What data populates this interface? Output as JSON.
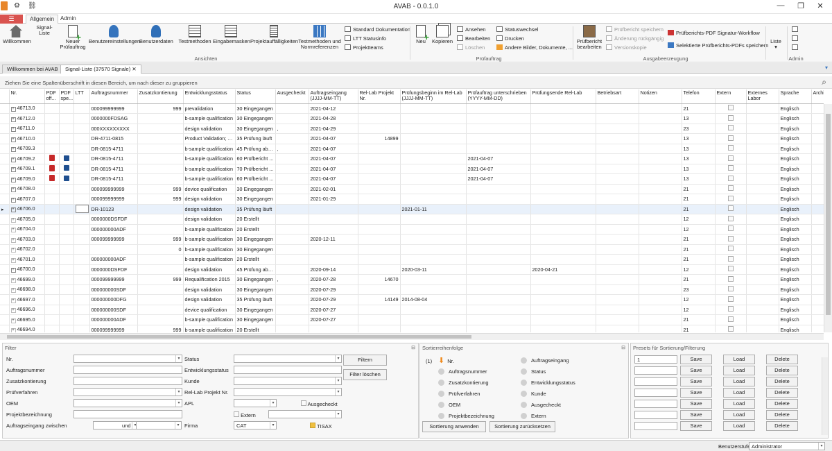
{
  "window": {
    "title": "AVAB - 0.0.1.0",
    "min": "—",
    "max": "❐",
    "close": "✕"
  },
  "ribbon_tabs": [
    {
      "label": "Allgemein"
    },
    {
      "label": "Admin"
    }
  ],
  "ribbon": {
    "buttons": [
      {
        "label": "Willkommen"
      },
      {
        "label": "Signal-Liste"
      },
      {
        "label": "Neuer Prüfauftrag"
      },
      {
        "label": "Benutzereinstellungen"
      },
      {
        "label": "Benutzerdaten"
      },
      {
        "label": "Testmethoden"
      },
      {
        "label": "Eingabemasken"
      },
      {
        "label": "Projektauffälligkeiten"
      },
      {
        "label": "Testmethoden und Normreferenzen"
      },
      {
        "label": "Neu"
      },
      {
        "label": "Kopieren"
      },
      {
        "label": "Prüfbericht bearbeiten"
      },
      {
        "label": "Liste"
      }
    ],
    "small": [
      {
        "label": "Standard Dokumentation"
      },
      {
        "label": "LTT Statusinfo"
      },
      {
        "label": "Projektteams"
      },
      {
        "label": "Ansehen"
      },
      {
        "label": "Bearbeiten"
      },
      {
        "label": "Löschen"
      },
      {
        "label": "Statuswechsel"
      },
      {
        "label": "Drucken"
      },
      {
        "label": "Andere Bilder, Dokumente, ..."
      },
      {
        "label": "Prüfbericht speichern"
      },
      {
        "label": "Änderung rückgängig"
      },
      {
        "label": "Versionskopie"
      },
      {
        "label": "Prüfberichts-PDF Signatur-Workflow"
      },
      {
        "label": "Selektierte Prüfberichts-PDFs speichern"
      }
    ],
    "groups": [
      {
        "label": "Ansichten"
      },
      {
        "label": "Prüfauftrag"
      },
      {
        "label": "Ausgabeerzeugung"
      },
      {
        "label": "Admin"
      }
    ]
  },
  "doc_tabs": [
    {
      "label": "Willkommen bei AVAB"
    },
    {
      "label": "Signal-Liste (37570 Signale)"
    }
  ],
  "group_hint": "Ziehen Sie eine Spaltenüberschrift in diesen Bereich, um nach dieser zu gruppieren",
  "columns": [
    "",
    "Nr.",
    "PDF off...",
    "PDF spe...",
    "LTT",
    "Auftragsnummer",
    "Zusatzkontierung",
    "Entwicklungsstatus",
    "Status",
    "Ausgecheckt",
    "Auftragseingang (JJJJ-MM-TT)",
    "Rel-Lab Projekt Nr.",
    "Prüfungsbeginn im Rel-Lab (JJJJ-MM-TT)",
    "Prüfauftrag unterschrieben (YYYY-MM-DD)",
    "Prüfungsende Rel-Lab",
    "Betriebsart",
    "Notizen",
    "Telefon",
    "Extern",
    "Externes Labor",
    "Sprache",
    "Archiv"
  ],
  "rows": [
    {
      "nr": "46713.0",
      "pdf": false,
      "save": false,
      "auftrag": "000099999999",
      "zusatz": "999",
      "entw": "prevalidation",
      "status": "30 Eingegangen",
      "aus": "",
      "eingang": "2021-04-12",
      "rellab": "",
      "beginn": "",
      "unter": "",
      "ende": "",
      "tel": "21",
      "lang": "Englisch"
    },
    {
      "nr": "46712.0",
      "pdf": false,
      "save": false,
      "auftrag": "0000000FDSAG",
      "zusatz": "",
      "entw": "b-sample qualification",
      "status": "30 Eingegangen",
      "aus": "",
      "eingang": "2021-04-28",
      "rellab": "",
      "beginn": "",
      "unter": "",
      "ende": "",
      "tel": "13",
      "lang": "Englisch"
    },
    {
      "nr": "46711.0",
      "pdf": false,
      "save": false,
      "auftrag": "000XXXXXXXXX",
      "zusatz": "",
      "entw": "design validation",
      "status": "30 Eingegangen",
      "aus": ",",
      "eingang": "2021-04-29",
      "rellab": "",
      "beginn": "",
      "unter": "",
      "ende": "",
      "tel": "23",
      "lang": "Englisch"
    },
    {
      "nr": "46710.0",
      "pdf": false,
      "save": false,
      "auftrag": "DR-4711-0815",
      "zusatz": "",
      "entw": "Product Validation; PV",
      "status": "35 Prüfung läuft",
      "aus": "",
      "eingang": "2021-04-07",
      "rellab": "14899",
      "beginn": "",
      "unter": "",
      "ende": "",
      "tel": "13",
      "lang": "Englisch"
    },
    {
      "nr": "46709.3",
      "pdf": false,
      "save": false,
      "auftrag": "DR-0815-4711",
      "zusatz": "",
      "entw": "b-sample qualification",
      "status": "45 Prüfung abg...",
      "aus": ",",
      "eingang": "2021-04-07",
      "rellab": "",
      "beginn": "",
      "unter": "",
      "ende": "",
      "tel": "13",
      "lang": "Englisch"
    },
    {
      "nr": "46709.2",
      "pdf": true,
      "save": true,
      "auftrag": "DR-0815-4711",
      "zusatz": "",
      "entw": "b-sample qualification",
      "status": "60 Prüfbericht ...",
      "aus": "",
      "eingang": "2021-04-07",
      "rellab": "",
      "beginn": "",
      "unter": "2021-04-07",
      "ende": "",
      "tel": "13",
      "lang": "Englisch"
    },
    {
      "nr": "46709.1",
      "pdf": true,
      "save": true,
      "auftrag": "DR-0815-4711",
      "zusatz": "",
      "entw": "b-sample qualification",
      "status": "70 Prüfbericht ...",
      "aus": "",
      "eingang": "2021-04-07",
      "rellab": "",
      "beginn": "",
      "unter": "2021-04-07",
      "ende": "",
      "tel": "13",
      "lang": "Englisch"
    },
    {
      "nr": "46709.0",
      "pdf": true,
      "save": true,
      "auftrag": "DR-0815-4711",
      "zusatz": "",
      "entw": "b-sample qualification",
      "status": "60 Prüfbericht ...",
      "aus": "",
      "eingang": "2021-04-07",
      "rellab": "",
      "beginn": "",
      "unter": "2021-04-07",
      "ende": "",
      "tel": "13",
      "lang": "Englisch"
    },
    {
      "nr": "46708.0",
      "pdf": false,
      "save": false,
      "auftrag": "000099999999",
      "zusatz": "999",
      "entw": "device qualification",
      "status": "30 Eingegangen",
      "aus": "",
      "eingang": "2021-02-01",
      "rellab": "",
      "beginn": "",
      "unter": "",
      "ende": "",
      "tel": "21",
      "lang": "Englisch"
    },
    {
      "nr": "46707.0",
      "pdf": false,
      "save": false,
      "auftrag": "000099999999",
      "zusatz": "999",
      "entw": "design validation",
      "status": "30 Eingegangen",
      "aus": "",
      "eingang": "2021-01-29",
      "rellab": "",
      "beginn": "",
      "unter": "",
      "ende": "",
      "tel": "21",
      "lang": "Englisch"
    },
    {
      "nr": "46706.0",
      "pdf": false,
      "save": false,
      "auftrag": "DR-10123",
      "zusatz": "",
      "entw": "design validation",
      "status": "35 Prüfung läuft",
      "aus": "",
      "eingang": "",
      "rellab": "",
      "beginn": "2021-01-11",
      "unter": "",
      "ende": "",
      "tel": "21",
      "lang": "Englisch",
      "selected": true
    },
    {
      "nr": "46705.0",
      "pdf": false,
      "save": false,
      "auftrag": "0000000DSFDF",
      "zusatz": "",
      "entw": "design validation",
      "status": "20 Erstellt",
      "aus": "",
      "eingang": "",
      "rellab": "",
      "beginn": "",
      "unter": "",
      "ende": "",
      "tel": "12",
      "lang": "Englisch"
    },
    {
      "nr": "46704.0",
      "pdf": false,
      "save": false,
      "auftrag": "000000000ADF",
      "zusatz": "",
      "entw": "b-sample qualification",
      "status": "20 Erstellt",
      "aus": "",
      "eingang": "",
      "rellab": "",
      "beginn": "",
      "unter": "",
      "ende": "",
      "tel": "12",
      "lang": "Englisch"
    },
    {
      "nr": "46703.0",
      "pdf": false,
      "save": false,
      "auftrag": "000099999999",
      "zusatz": "999",
      "entw": "b-sample qualification",
      "status": "30 Eingegangen",
      "aus": "",
      "eingang": "2020-12-11",
      "rellab": "",
      "beginn": "",
      "unter": "",
      "ende": "",
      "tel": "21",
      "lang": "Englisch"
    },
    {
      "nr": "46702.0",
      "pdf": false,
      "save": false,
      "auftrag": "",
      "zusatz": "0",
      "entw": "b-sample qualification",
      "status": "30 Eingegangen",
      "aus": "",
      "eingang": "",
      "rellab": "",
      "beginn": "",
      "unter": "",
      "ende": "",
      "tel": "21",
      "lang": "Englisch"
    },
    {
      "nr": "46701.0",
      "pdf": false,
      "save": false,
      "auftrag": "000000000ADF",
      "zusatz": "",
      "entw": "b-sample qualification",
      "status": "20 Erstellt",
      "aus": "",
      "eingang": "",
      "rellab": "",
      "beginn": "",
      "unter": "",
      "ende": "",
      "tel": "21",
      "lang": "Englisch"
    },
    {
      "nr": "46700.0",
      "pdf": false,
      "save": false,
      "auftrag": "0000000DSFDF",
      "zusatz": "",
      "entw": "design validation",
      "status": "45 Prüfung abg...",
      "aus": "",
      "eingang": "2020-09-14",
      "rellab": "",
      "beginn": "2020-03-11",
      "unter": "",
      "ende": "2020-04-21",
      "tel": "12",
      "lang": "Englisch"
    },
    {
      "nr": "46699.0",
      "pdf": false,
      "save": false,
      "auftrag": "000099999999",
      "zusatz": "999",
      "entw": "Requalification 2015",
      "status": "30 Eingegangen",
      "aus": ",",
      "eingang": "2020-07-28",
      "rellab": "14670",
      "beginn": "",
      "unter": "",
      "ende": "",
      "tel": "21",
      "lang": "Englisch"
    },
    {
      "nr": "46698.0",
      "pdf": false,
      "save": false,
      "auftrag": "000000000SDF",
      "zusatz": "",
      "entw": "design validation",
      "status": "30 Eingegangen",
      "aus": "",
      "eingang": "2020-07-29",
      "rellab": "",
      "beginn": "",
      "unter": "",
      "ende": "",
      "tel": "23",
      "lang": "Englisch"
    },
    {
      "nr": "46697.0",
      "pdf": false,
      "save": false,
      "auftrag": "000000000DFG",
      "zusatz": "",
      "entw": "design validation",
      "status": "35 Prüfung läuft",
      "aus": "",
      "eingang": "2020-07-29",
      "rellab": "14149",
      "beginn": "2014-08-04",
      "unter": "",
      "ende": "",
      "tel": "12",
      "lang": "Englisch"
    },
    {
      "nr": "46696.0",
      "pdf": false,
      "save": false,
      "auftrag": "000000000SDF",
      "zusatz": "",
      "entw": "device qualification",
      "status": "30 Eingegangen",
      "aus": "",
      "eingang": "2020-07-27",
      "rellab": "",
      "beginn": "",
      "unter": "",
      "ende": "",
      "tel": "12",
      "lang": "Englisch"
    },
    {
      "nr": "46695.0",
      "pdf": false,
      "save": false,
      "auftrag": "000000000ADF",
      "zusatz": "",
      "entw": "b-sample qualification",
      "status": "30 Eingegangen",
      "aus": "",
      "eingang": "2020-07-27",
      "rellab": "",
      "beginn": "",
      "unter": "",
      "ende": "",
      "tel": "21",
      "lang": "Englisch"
    },
    {
      "nr": "46694.0",
      "pdf": false,
      "save": false,
      "auftrag": "000099999999",
      "zusatz": "999",
      "entw": "b-sample qualification",
      "status": "20 Erstellt",
      "aus": "",
      "eingang": "",
      "rellab": "",
      "beginn": "",
      "unter": "",
      "ende": "",
      "tel": "21",
      "lang": "Englisch"
    }
  ],
  "filter": {
    "title": "Filter",
    "labels": {
      "nr": "Nr.",
      "auftrag": "Auftragsnummer",
      "zusatz": "Zusatzkontierung",
      "pruef": "Prüfverfahren",
      "oem": "OEM",
      "projekt": "Projektbezeichnung",
      "zwischen": "Auftragseingang zwischen",
      "und": "und",
      "status": "Status",
      "entw": "Entwicklungsstatus",
      "kunde": "Kunde",
      "rellab": "Rel-Lab Projekt Nr.",
      "apl": "APL",
      "extern": "Extern",
      "firma": "Firma",
      "ausgecheckt": "Ausgecheckt",
      "tisax": "TISAX"
    },
    "firma_value": "CAT",
    "btn_filter": "Filtern",
    "btn_clear": "Filter löschen"
  },
  "sort": {
    "title": "Sortierreihenfolge",
    "index": "(1)",
    "left": [
      "Nr.",
      "Auftragsnummer",
      "Zusatzkontierung",
      "Prüfverfahren",
      "OEM",
      "Projektbezeichnung"
    ],
    "right": [
      "Auftragseingang",
      "Status",
      "Entwicklungsstatus",
      "Kunde",
      "Ausgecheckt",
      "Extern"
    ],
    "btn_apply": "Sortierung anwenden",
    "btn_reset": "Sortierung zurücksetzen"
  },
  "presets": {
    "title": "Presets für Sortierung/Filterung",
    "first_value": "1",
    "save": "Save",
    "load": "Load",
    "delete": "Delete"
  },
  "status": {
    "label": "Benutzerstufe",
    "value": "Administrator"
  }
}
